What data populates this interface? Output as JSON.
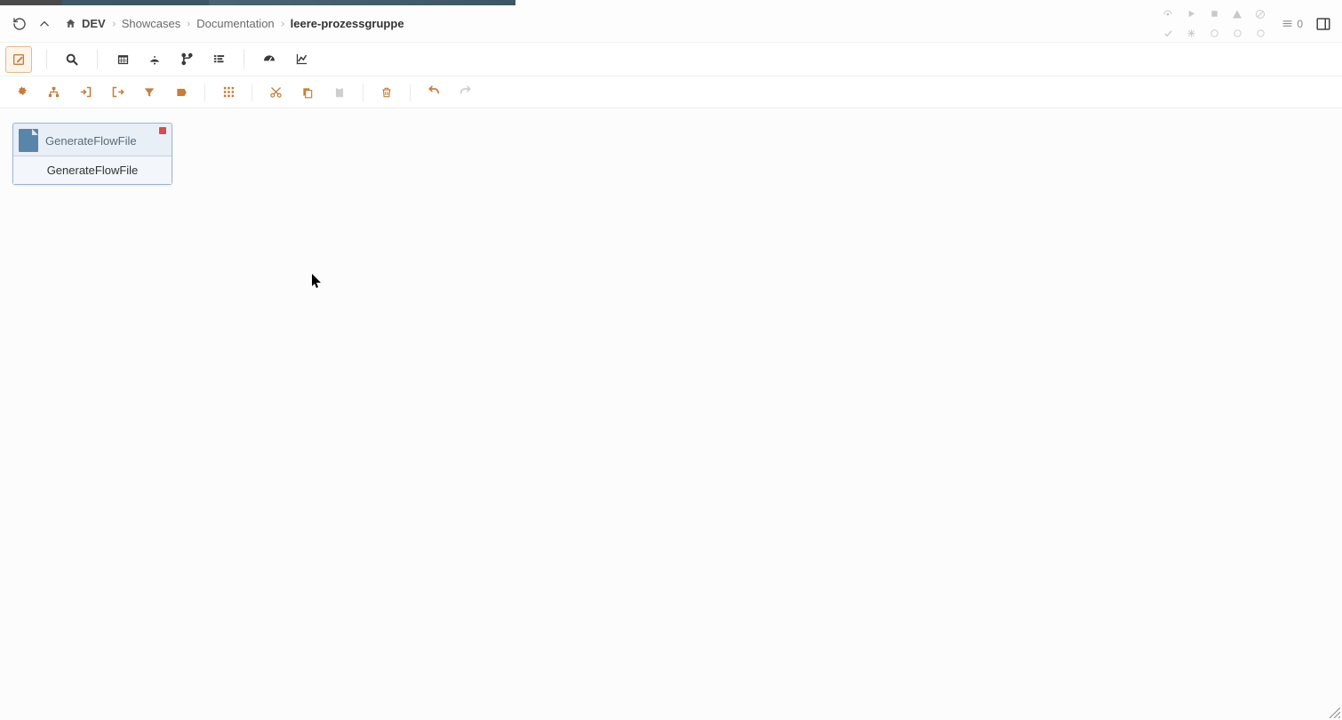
{
  "breadcrumbs": {
    "root": "DEV",
    "items": [
      "Showcases",
      "Documentation",
      "leere-prozessgruppe"
    ]
  },
  "topbar_right": {
    "count": "0"
  },
  "canvas": {
    "processor": {
      "title": "GenerateFlowFile",
      "type": "GenerateFlowFile"
    }
  }
}
